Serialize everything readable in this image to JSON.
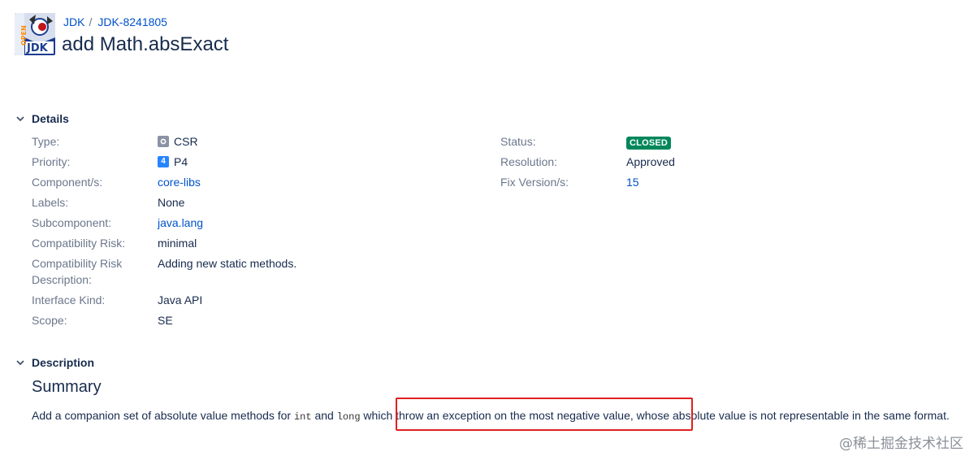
{
  "breadcrumbs": {
    "project": "JDK",
    "separator": "/",
    "issue_key": "JDK-8241805"
  },
  "issue": {
    "title": "add Math.absExact"
  },
  "logo": {
    "open_text": "OPEN",
    "jdk_text": "JDK"
  },
  "details": {
    "heading": "Details",
    "left": [
      {
        "label": "Type:",
        "value": "CSR",
        "icon": "csr-type-icon"
      },
      {
        "label": "Priority:",
        "value": "P4",
        "icon": "priority-icon"
      },
      {
        "label": "Component/s:",
        "value": "core-libs"
      },
      {
        "label": "Labels:",
        "value": "None"
      },
      {
        "label": "Subcomponent:",
        "value": "java.lang"
      },
      {
        "label": "Compatibility Risk:",
        "value": "minimal"
      },
      {
        "label": "Compatibility Risk Description:",
        "value": "Adding new static methods."
      },
      {
        "label": "Interface Kind:",
        "value": "Java API"
      },
      {
        "label": "Scope:",
        "value": "SE"
      }
    ],
    "right": [
      {
        "label": "Status:",
        "value": "CLOSED"
      },
      {
        "label": "Resolution:",
        "value": "Approved"
      },
      {
        "label": "Fix Version/s:",
        "value": "15"
      }
    ]
  },
  "description": {
    "heading": "Description",
    "summary_heading": "Summary",
    "text_part1": "Add a companion set of absolute value methods for ",
    "code1": "int",
    "text_part2": " and ",
    "code2": "long",
    "text_part3": " which throw an exception on the most negative value, whose absolute value is not representable in the same format."
  },
  "watermark": "@稀土掘金技术社区",
  "colors": {
    "link": "#0052cc",
    "label": "#6b778c",
    "status_closed": "#00875a",
    "highlight": "#e02020"
  }
}
